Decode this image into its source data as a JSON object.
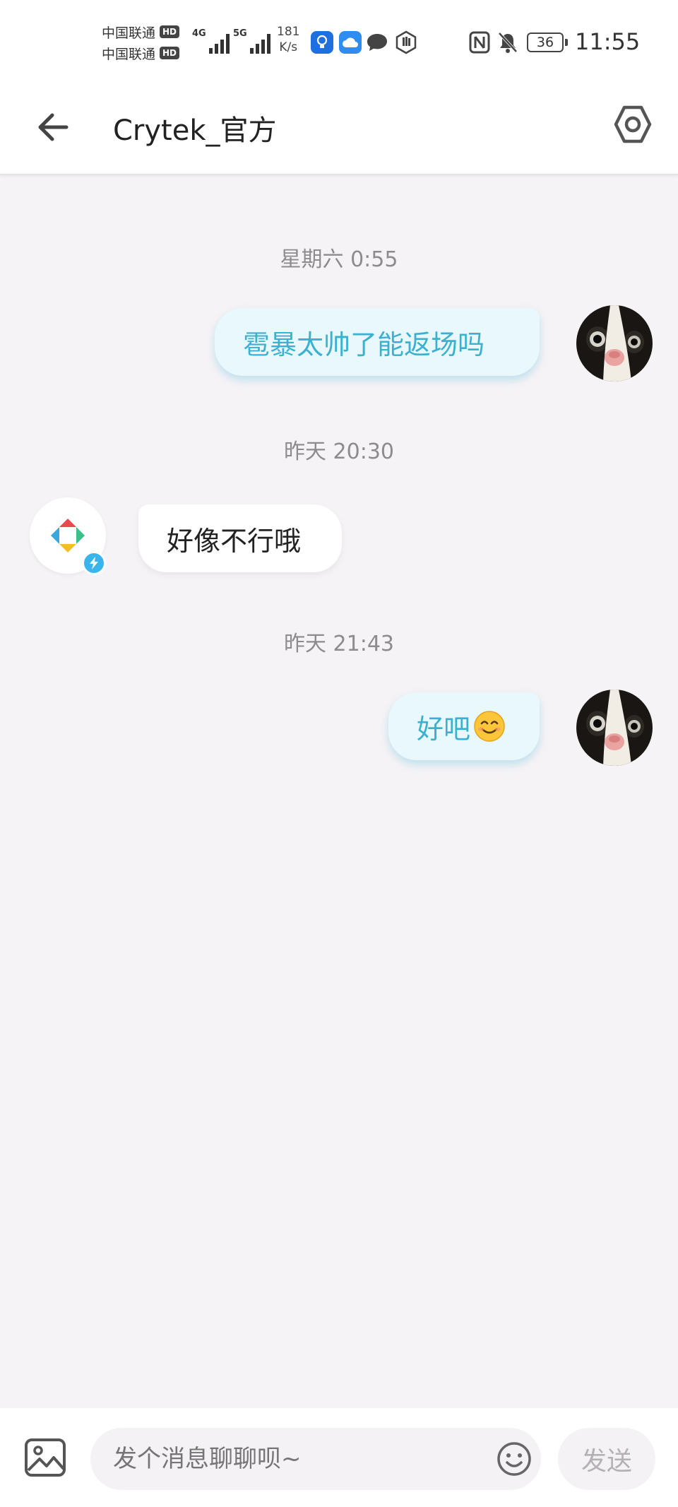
{
  "status_bar": {
    "carrier_1": "中国联通",
    "carrier_2": "中国联通",
    "hd_badge": "HD",
    "signal_1_label": "4G",
    "signal_2_label": "5G",
    "speed_value": "181",
    "speed_unit": "K/s",
    "app_icons": [
      "bulb-app-icon",
      "cloud-app-icon",
      "chat-app-icon",
      "hand-app-icon"
    ],
    "system_icons": [
      "nfc-icon",
      "mute-icon"
    ],
    "battery_level": "36",
    "time": "11:55"
  },
  "header": {
    "title": "Crytek_官方",
    "back_icon": "arrow-left-icon",
    "settings_icon": "hexagon-settings-icon"
  },
  "messages": [
    {
      "type": "timestamp",
      "text": "星期六 0:55"
    },
    {
      "type": "outgoing",
      "text": "雹暴太帅了能返场吗",
      "avatar": "cat-avatar"
    },
    {
      "type": "timestamp",
      "text": "昨天 20:30"
    },
    {
      "type": "incoming",
      "text": "好像不行哦",
      "avatar": "crytek-logo-avatar",
      "badge": "verified-lightning-icon"
    },
    {
      "type": "timestamp",
      "text": "昨天 21:43"
    },
    {
      "type": "outgoing",
      "text": "好吧",
      "emoji": "smiling-face-emoji",
      "avatar": "cat-avatar"
    }
  ],
  "input_bar": {
    "placeholder": "发个消息聊聊呗~",
    "send_label": "发送",
    "image_icon": "image-icon",
    "emoji_icon": "emoji-icon"
  },
  "colors": {
    "outgoing_text": "#3bb1cf",
    "outgoing_bubble": "#e8f8fc",
    "chat_background": "#f6f3f6",
    "badge_blue": "#39b5ec"
  }
}
